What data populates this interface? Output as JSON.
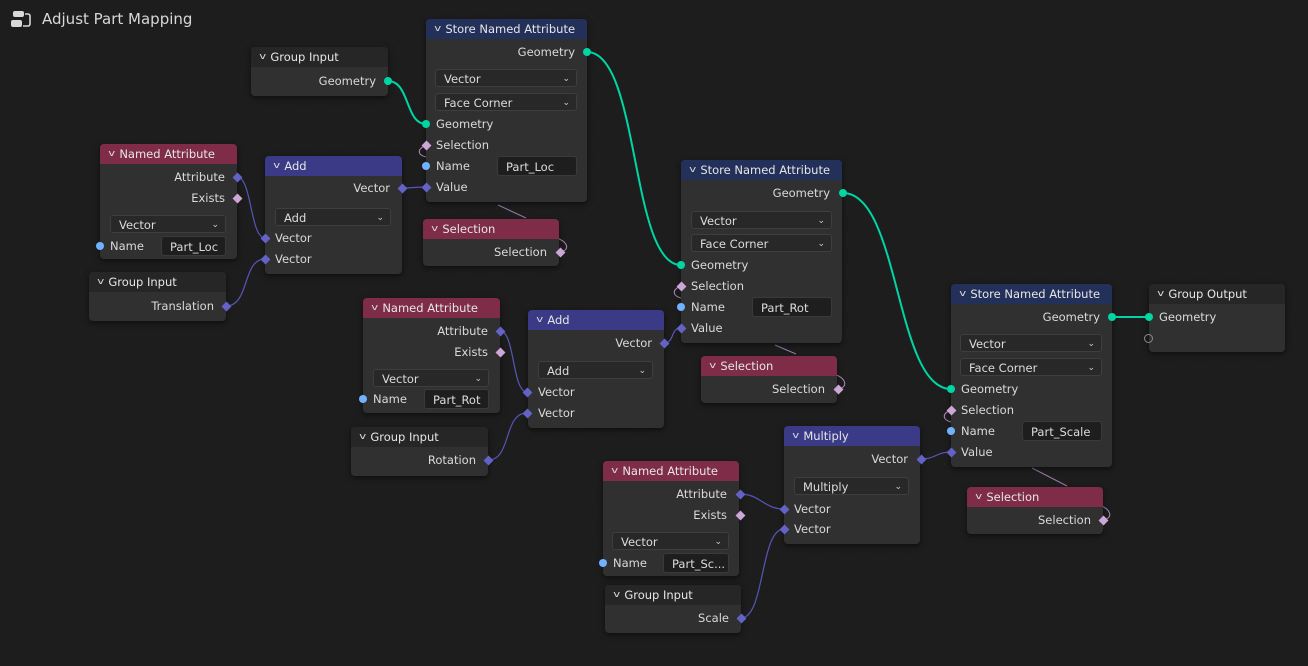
{
  "header": {
    "title": "Adjust Part Mapping",
    "icon": "node-tree-icon"
  },
  "colors": {
    "geometry_socket": "#00d6a3",
    "vector_socket": "#6363c7",
    "boolean_socket": "#cca6d6",
    "string_socket": "#70b2ff",
    "store_header": "#23305a",
    "attribute_header": "#7e2c48",
    "math_header": "#3a3a86",
    "group_header": "#262626"
  },
  "nodes": {
    "group_input_geo": {
      "title": "Group Input",
      "outputs": [
        "Geometry"
      ]
    },
    "named_attr_loc": {
      "title": "Named Attribute",
      "outputs": [
        "Attribute",
        "Exists"
      ],
      "data_type": "Vector",
      "name_label": "Name",
      "name_value": "Part_Loc"
    },
    "group_input_trans": {
      "title": "Group Input",
      "outputs": [
        "Translation"
      ]
    },
    "add_loc": {
      "title": "Add",
      "output": "Vector",
      "operation": "Add",
      "inputs": [
        "Vector",
        "Vector"
      ]
    },
    "store_loc": {
      "title": "Store Named Attribute",
      "output": "Geometry",
      "data_type": "Vector",
      "domain": "Face Corner",
      "inputs": [
        "Geometry",
        "Selection",
        "Name",
        "Value"
      ],
      "name_value": "Part_Loc"
    },
    "selection_1": {
      "title": "Selection",
      "output": "Selection"
    },
    "named_attr_rot": {
      "title": "Named Attribute",
      "outputs": [
        "Attribute",
        "Exists"
      ],
      "data_type": "Vector",
      "name_label": "Name",
      "name_value": "Part_Rot"
    },
    "group_input_rot": {
      "title": "Group Input",
      "outputs": [
        "Rotation"
      ]
    },
    "add_rot": {
      "title": "Add",
      "output": "Vector",
      "operation": "Add",
      "inputs": [
        "Vector",
        "Vector"
      ]
    },
    "store_rot": {
      "title": "Store Named Attribute",
      "output": "Geometry",
      "data_type": "Vector",
      "domain": "Face Corner",
      "inputs": [
        "Geometry",
        "Selection",
        "Name",
        "Value"
      ],
      "name_value": "Part_Rot"
    },
    "selection_2": {
      "title": "Selection",
      "output": "Selection"
    },
    "named_attr_scale": {
      "title": "Named Attribute",
      "outputs": [
        "Attribute",
        "Exists"
      ],
      "data_type": "Vector",
      "name_label": "Name",
      "name_value": "Part_Sc..."
    },
    "group_input_scale": {
      "title": "Group Input",
      "outputs": [
        "Scale"
      ]
    },
    "multiply_scale": {
      "title": "Multiply",
      "output": "Vector",
      "operation": "Multiply",
      "inputs": [
        "Vector",
        "Vector"
      ]
    },
    "store_scale": {
      "title": "Store Named Attribute",
      "output": "Geometry",
      "data_type": "Vector",
      "domain": "Face Corner",
      "inputs": [
        "Geometry",
        "Selection",
        "Name",
        "Value"
      ],
      "name_value": "Part_Scale"
    },
    "selection_3": {
      "title": "Selection",
      "output": "Selection"
    },
    "group_output": {
      "title": "Group Output",
      "inputs": [
        "Geometry"
      ]
    }
  }
}
